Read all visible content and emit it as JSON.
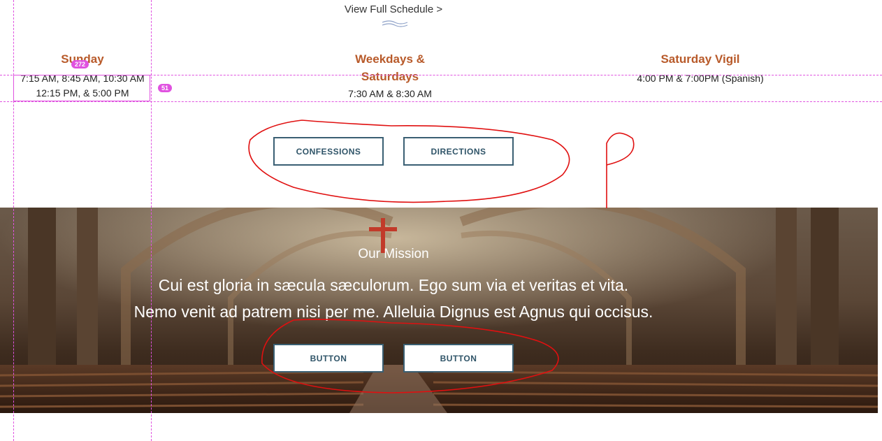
{
  "schedule_link": "View Full Schedule >",
  "mass_times": [
    {
      "title": "Sunday",
      "lines": [
        "7:15 AM, 8:45 AM, 10:30 AM",
        "12:15 PM, & 5:00 PM"
      ]
    },
    {
      "title_line1": "Weekdays &",
      "title_line2": "Saturdays",
      "lines": [
        "7:30 AM & 8:30 AM"
      ]
    },
    {
      "title": "Saturday Vigil",
      "lines": [
        "4:00 PM & 7:00PM (Spanish)"
      ]
    }
  ],
  "action_buttons": {
    "confessions": "CONFESSIONS",
    "directions": "DIRECTIONS"
  },
  "mission": {
    "heading": "Our Mission",
    "line1": "Cui est gloria in sæcula sæculorum. Ego sum via et veritas et vita.",
    "line2": "Nemo venit ad patrem nisi per me. Alleluia Dignus est Agnus qui occisus.",
    "button1": "BUTTON",
    "button2": "BUTTON"
  },
  "dev_overlay": {
    "width_badge": "272",
    "height_badge": "51"
  },
  "colors": {
    "accent": "#b85a2a",
    "button_border": "#3a5f73",
    "annotation": "#e01010",
    "guide": "#e052e0"
  }
}
